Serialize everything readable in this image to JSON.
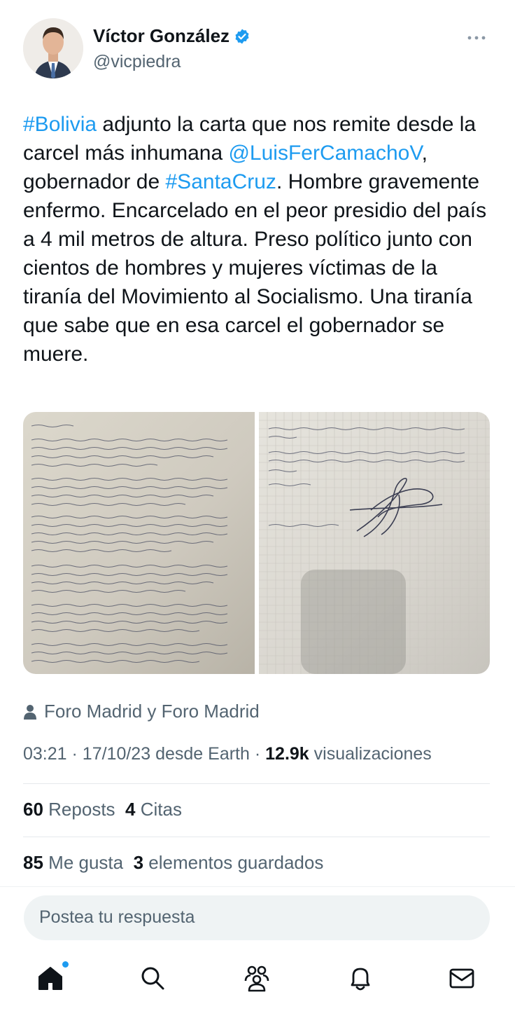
{
  "author": {
    "name": "Víctor González",
    "handle": "@vicpiedra"
  },
  "icons": {
    "verified": "verified-badge-icon",
    "more": "more-options-icon",
    "account": "person-icon",
    "nav": [
      "home-icon",
      "search-icon",
      "communities-icon",
      "notifications-icon",
      "messages-icon"
    ]
  },
  "colors": {
    "link": "#1d9bf0",
    "secondary_text": "#536471",
    "primary_text": "#0f1419"
  },
  "tweet": {
    "segments": [
      {
        "text": "#Bolivia",
        "link": true
      },
      {
        "text": " adjunto la carta que nos remite desde la carcel más inhumana  ",
        "link": false
      },
      {
        "text": "@LuisFerCamachoV",
        "link": true
      },
      {
        "text": ", gobernador de ",
        "link": false
      },
      {
        "text": "#SantaCruz",
        "link": true
      },
      {
        "text": ". Hombre gravemente enfermo. Encarcelado en el peor presidio del país a 4 mil metros de altura. Preso político junto con cientos de hombres y mujeres víctimas de la tiranía del Movimiento al Socialismo. Una tiranía que sabe que en esa carcel el gobernador se muere.",
        "link": false
      }
    ]
  },
  "account_label": "Foro Madrid y Foro Madrid",
  "meta": {
    "time": "03:21",
    "date": "17/10/23",
    "source": "desde Earth",
    "separator": "·",
    "views_count": "12.9k",
    "views_label": "visualizaciones"
  },
  "stats": {
    "reposts_count": "60",
    "reposts_label": "Reposts",
    "quotes_count": "4",
    "quotes_label": "Citas",
    "likes_count": "85",
    "likes_label": "Me gusta",
    "bookmarks_count": "3",
    "bookmarks_label": "elementos guardados"
  },
  "reply": {
    "placeholder": "Postea tu respuesta"
  }
}
